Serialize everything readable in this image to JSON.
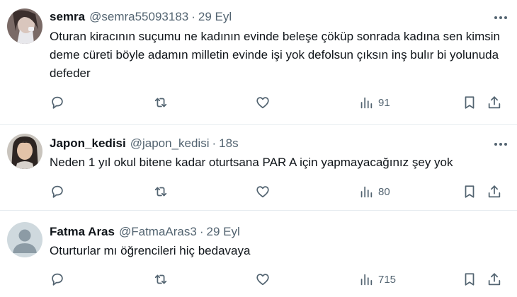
{
  "tweets": [
    {
      "name": "semra",
      "handle": "@semra55093183",
      "dot": "·",
      "time": "29 Eyl",
      "text": "Oturan kiracının suçumu ne kadının evinde beleşe çöküp sonrada kadına sen kimsin deme cüreti böyle adamın milletin evinde işi yok defolsun çıksın inş bulır bi yolunuda defeder",
      "views": "91"
    },
    {
      "name": "Japon_kedisi",
      "handle": "@japon_kedisi",
      "dot": "·",
      "time": "18s",
      "text": "Neden 1 yıl okul bitene kadar oturtsana PAR A için yapmayacağınız şey yok",
      "views": "80"
    },
    {
      "name": "Fatma Aras",
      "handle": "@FatmaAras3",
      "dot": "·",
      "time": "29 Eyl",
      "text": "Oturturlar mı öğrencileri hiç bedavaya",
      "views": "715"
    }
  ],
  "icons": {
    "reply": "speech-bubble-icon",
    "retweet": "repost-arrows-icon",
    "like": "heart-icon",
    "views": "bar-chart-icon",
    "bookmark": "bookmark-icon",
    "share": "share-upload-icon",
    "more": "three-dots-icon"
  },
  "colors": {
    "text": "#0f1419",
    "secondary": "#536471",
    "divider": "#e6ecf0",
    "background": "#ffffff"
  }
}
